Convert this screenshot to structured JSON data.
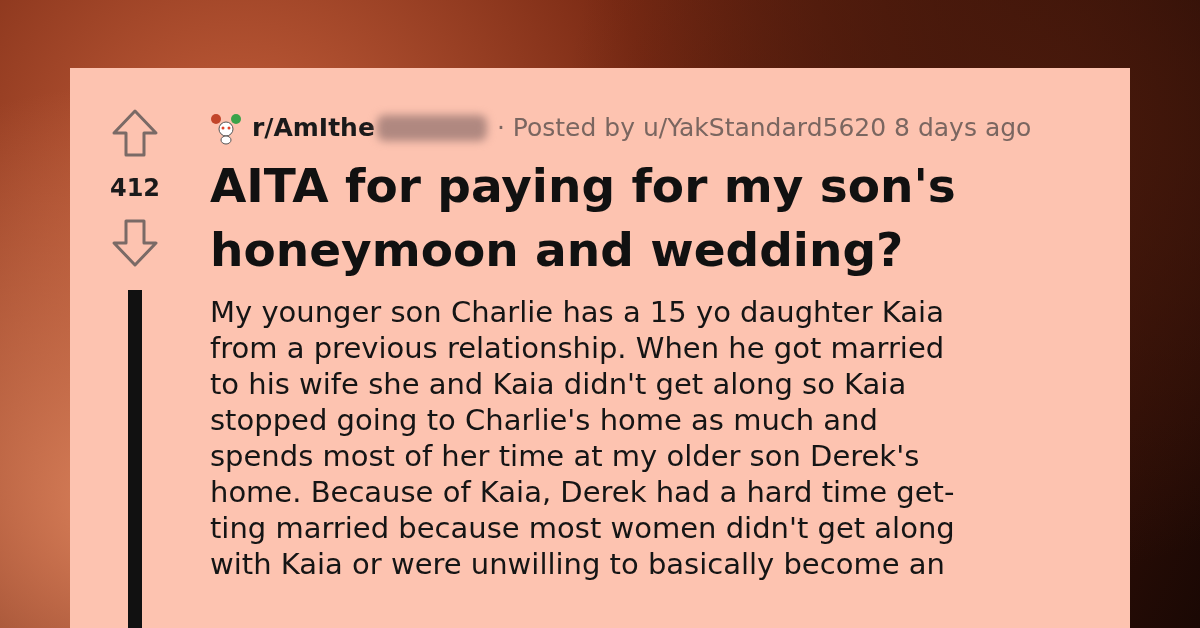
{
  "post": {
    "subreddit": "r/AmIthe",
    "meta": "· Posted by u/YakStandard5620 8 days ago",
    "votes": "412",
    "title_lines": [
      "AITA for paying for my son's",
      "honeymoon and wedding?"
    ],
    "body_lines": [
      "My younger son Charlie has a 15 yo daughter Kaia",
      "from a previous relationship. When he got married",
      "to his wife she and Kaia didn't get along so Kaia",
      "stopped going to Charlie's home as much and",
      "spends most of her time at my older son Derek's",
      "home. Because of Kaia, Derek had a hard time get-",
      "ting married because most women didn't get along",
      "with Kaia or were unwilling to basically become an"
    ]
  }
}
